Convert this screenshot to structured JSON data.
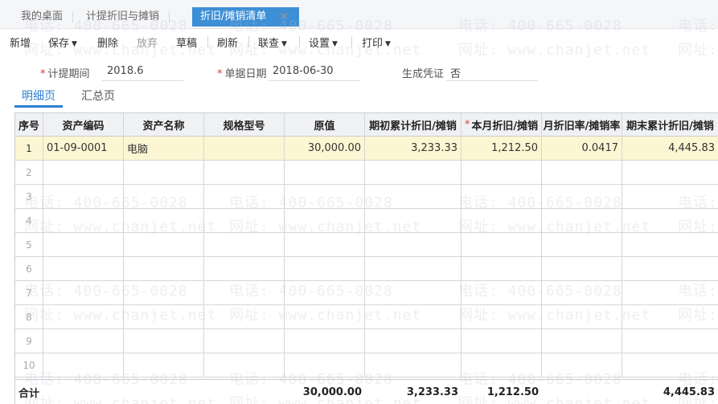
{
  "tabs": [
    {
      "label": "我的桌面"
    },
    {
      "label": "计提折旧与摊销"
    },
    {
      "label": "折旧/摊销清单",
      "close": "✕"
    }
  ],
  "toolbar": {
    "new": "新增",
    "save": "保存",
    "delete": "删除",
    "discard": "放弃",
    "draft": "草稿",
    "refresh": "刷新",
    "query": "联查",
    "settings": "设置",
    "print": "打印"
  },
  "form": {
    "period_label": "计提期间",
    "period_value": "2018.6",
    "date_label": "单据日期",
    "date_value": "2018-06-30",
    "voucher_label": "生成凭证",
    "voucher_value": "否"
  },
  "subtabs": {
    "detail": "明细页",
    "summary": "汇总页"
  },
  "table": {
    "headers": [
      "序号",
      "资产编码",
      "资产名称",
      "规格型号",
      "原值",
      "期初累计折旧/摊销",
      "本月折旧/摊销",
      "月折旧率/摊销率",
      "期末累计折旧/摊销"
    ],
    "rows": [
      {
        "no": "1",
        "code": "01-09-0001",
        "name": "电脑",
        "spec": "",
        "original": "30,000.00",
        "opening": "3,233.33",
        "month": "1,212.50",
        "rate": "0.0417",
        "closing": "4,445.83"
      },
      {
        "no": "2"
      },
      {
        "no": "3"
      },
      {
        "no": "4"
      },
      {
        "no": "5"
      },
      {
        "no": "6"
      },
      {
        "no": "7"
      },
      {
        "no": "8"
      },
      {
        "no": "9"
      },
      {
        "no": "10"
      }
    ],
    "total": {
      "label": "合计",
      "original": "30,000.00",
      "opening": "3,233.33",
      "month": "1,212.50",
      "closing": "4,445.83"
    }
  },
  "watermark": {
    "phone": "电话: 400-665-0028",
    "site": "网址: www.chanjet.net"
  }
}
